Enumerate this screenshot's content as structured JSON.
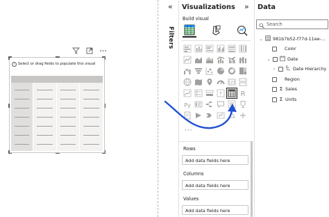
{
  "canvas": {
    "visual_message": "Select or drag fields to populate this visual",
    "visual_header_icons": [
      "filter-icon",
      "focus-mode-icon",
      "more-options-icon"
    ]
  },
  "filters": {
    "label": "Filters",
    "collapse_glyph": "«"
  },
  "visualizations": {
    "title": "Visualizations",
    "collapse_glyph": "»",
    "build_label": "Build visual",
    "build_tabs": [
      "build-visual-icon",
      "format-visual-icon",
      "analytics-icon"
    ],
    "more_glyph": "···",
    "selected_visual": "table-icon",
    "wells": [
      {
        "label": "Rows",
        "placeholder": "Add data fields here"
      },
      {
        "label": "Columns",
        "placeholder": "Add data fields here"
      },
      {
        "label": "Values",
        "placeholder": "Add data fields here"
      }
    ]
  },
  "data": {
    "title": "Data",
    "search_placeholder": "Search",
    "table_name": "981b7b52-f77d-11ee-...",
    "fields": [
      {
        "label": "Color",
        "type": "text"
      },
      {
        "label": "Date",
        "type": "date-table",
        "children": [
          {
            "label": "Date Hierarchy",
            "type": "hierarchy"
          }
        ]
      },
      {
        "label": "Region",
        "type": "text"
      },
      {
        "label": "Sales",
        "type": "sum"
      },
      {
        "label": "Units",
        "type": "sum"
      }
    ]
  },
  "colors": {
    "accent_arrow": "#1f4fd1",
    "text": "#252423",
    "border": "#c8c6c4"
  }
}
